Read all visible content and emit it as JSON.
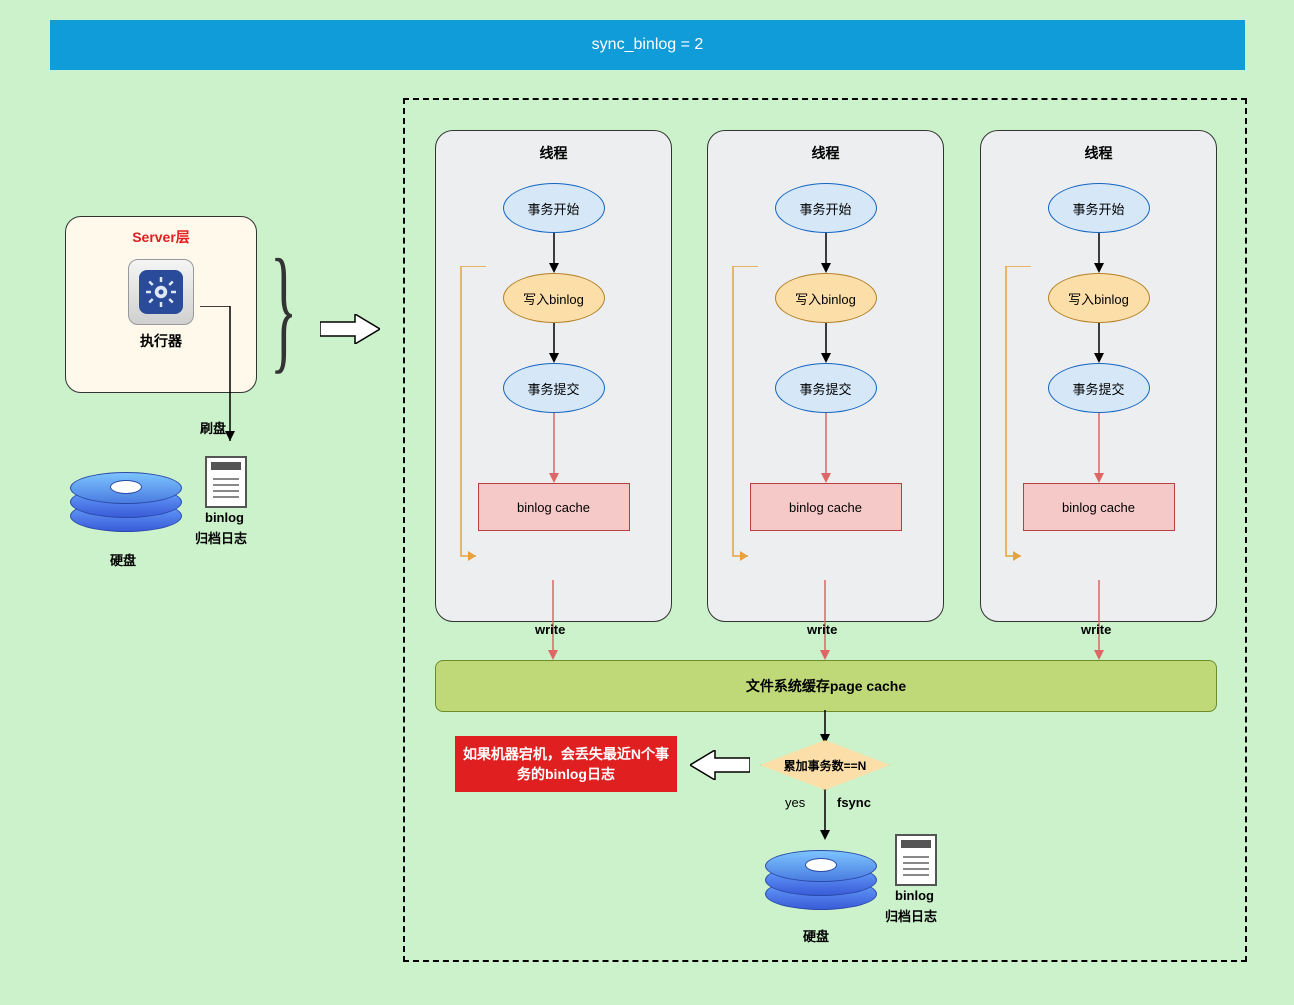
{
  "title": "sync_binlog = 2",
  "server": {
    "title": "Server层",
    "executor": "执行器"
  },
  "flush_label": "刷盘",
  "disk_label": "硬盘",
  "binlog_label1": "binlog",
  "binlog_label2": "归档日志",
  "thread_title": "线程",
  "tx_start": "事务开始",
  "write_binlog": "写入binlog",
  "tx_commit": "事务提交",
  "binlog_cache": "binlog cache",
  "write_label": "write",
  "page_cache": "文件系统缓存page cache",
  "cond": "累加事务数==N",
  "yes": "yes",
  "fsync": "fsync",
  "warn": "如果机器宕机，会丢失最近N个事务的binlog日志"
}
